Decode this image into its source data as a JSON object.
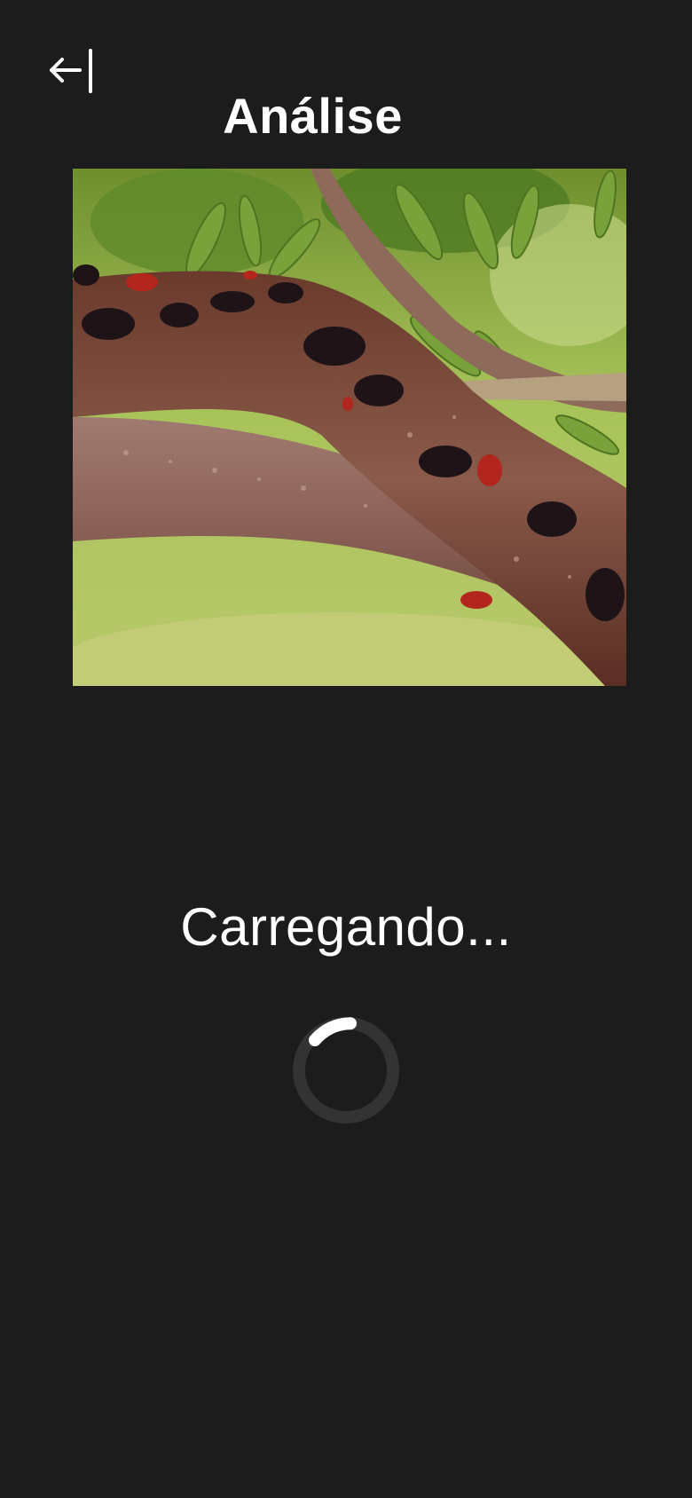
{
  "header": {
    "back_icon": "arrow-left-bar-icon",
    "title": "Análise"
  },
  "main": {
    "photo": {
      "subject": "tree-branch-photo"
    },
    "loading": {
      "text": "Carregando...",
      "spinner_icon": "loading-spinner-icon"
    }
  },
  "colors": {
    "background": "#1c1c1c",
    "text": "#ffffff",
    "spinner_track": "#333333",
    "spinner_arc": "#ffffff"
  }
}
